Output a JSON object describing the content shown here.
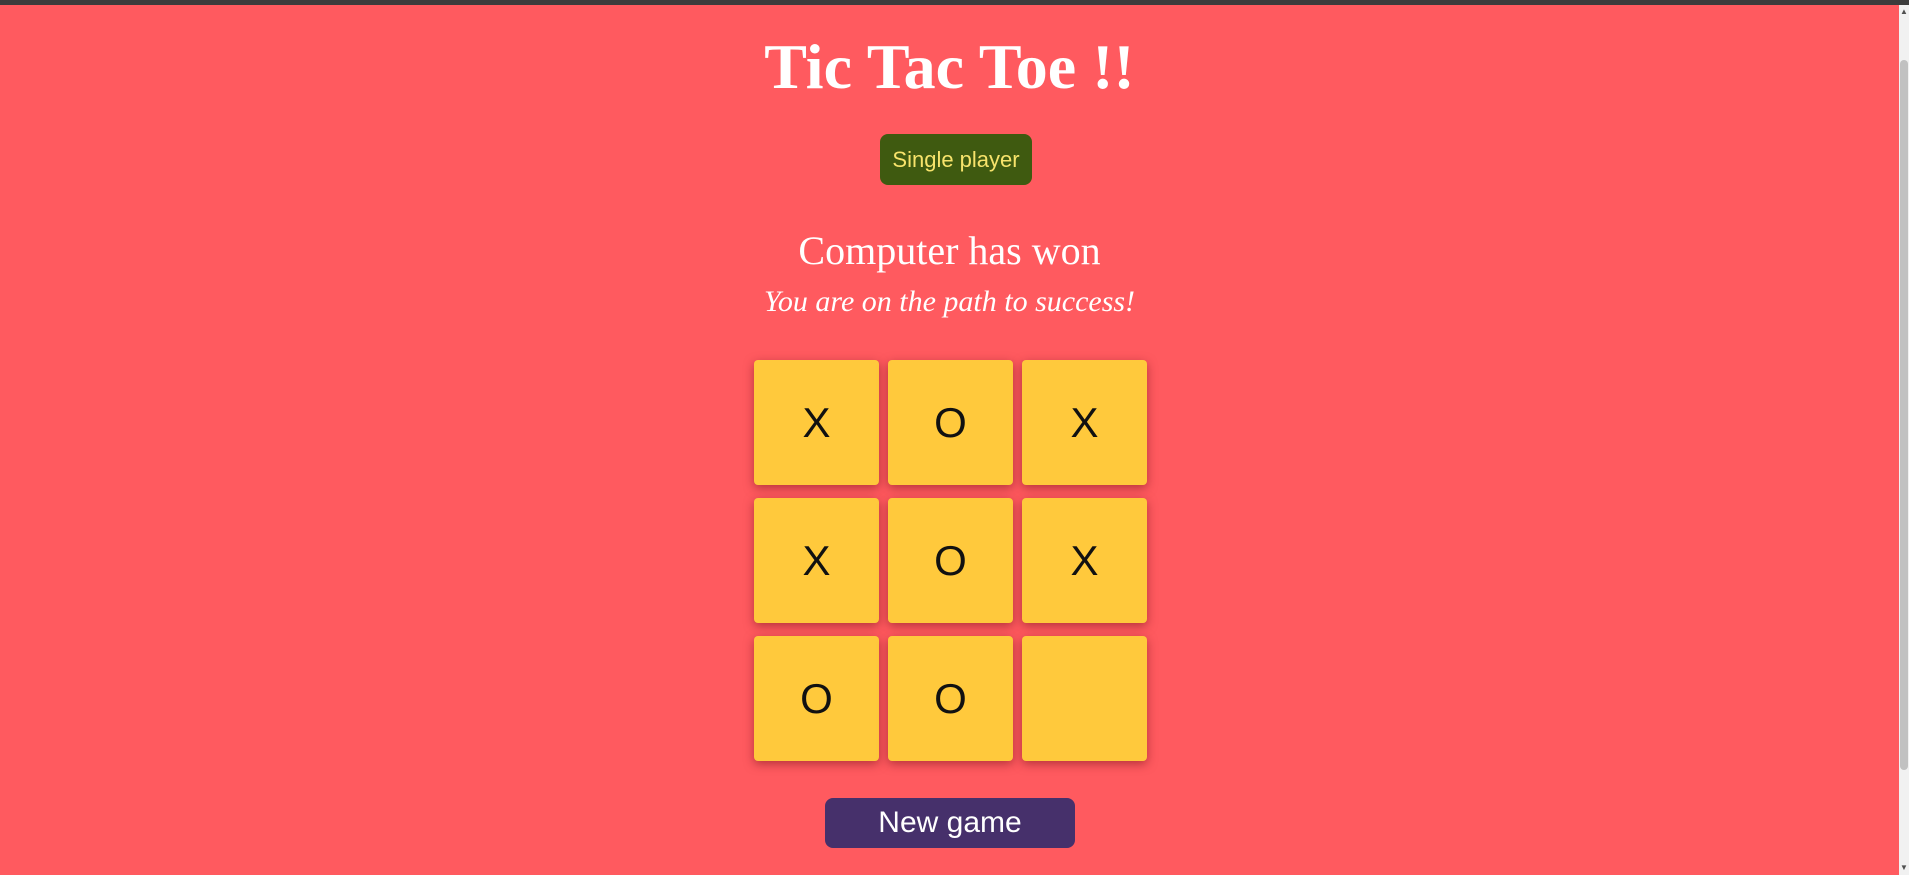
{
  "title": "Tic Tac Toe !!",
  "mode_button": "Single player",
  "status": "Computer has won",
  "motto": "You are on the path to success!",
  "board": {
    "cells": [
      "X",
      "O",
      "X",
      "X",
      "O",
      "X",
      "O",
      "O",
      ""
    ]
  },
  "new_game_button": "New game",
  "scrollbar": {
    "up_icon": "▲",
    "down_icon": "▼"
  },
  "colors": {
    "background": "#ff5a5f",
    "cell": "#ffc93c",
    "mode_button": "#3f5a10",
    "mode_button_text": "#f7e36b",
    "new_game_button": "#46306b"
  }
}
